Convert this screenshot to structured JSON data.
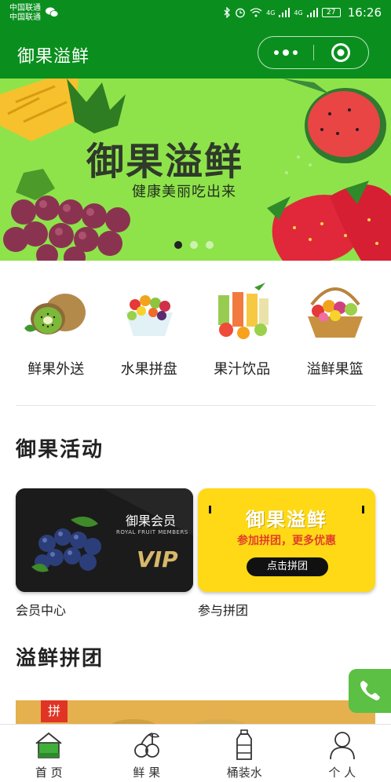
{
  "status_bar": {
    "carrier_1": "中国联通",
    "carrier_2": "中国联通",
    "network_1": "4G",
    "network_2": "4G",
    "battery": "27",
    "time": "16:26"
  },
  "header": {
    "title": "御果溢鲜"
  },
  "banner": {
    "title": "御果溢鲜",
    "subtitle": "健康美丽吃出来",
    "active_slide": 1,
    "slide_count": 3
  },
  "categories": [
    {
      "label": "鲜果外送",
      "icon": "kiwi-icon"
    },
    {
      "label": "水果拼盘",
      "icon": "fruit-platter-icon"
    },
    {
      "label": "果汁饮品",
      "icon": "juice-icon"
    },
    {
      "label": "溢鲜果篮",
      "icon": "fruit-basket-icon"
    }
  ],
  "activities": {
    "section_title": "御果活动",
    "vip_card": {
      "title": "御果会员",
      "subtitle": "ROYAL FRUIT MEMBERS",
      "mark": "VIP",
      "caption": "会员中心"
    },
    "group_card": {
      "title": "御果溢鲜",
      "subtitle": "参加拼团，更多优惠",
      "button": "点击拼团",
      "caption": "参与拼团"
    }
  },
  "group_buy": {
    "section_title": "溢鲜拼团",
    "tag": "拼"
  },
  "tabbar": [
    {
      "label": "首 页",
      "icon": "home-icon",
      "active": true
    },
    {
      "label": "鲜 果",
      "icon": "cherry-icon",
      "active": false
    },
    {
      "label": "桶装水",
      "icon": "water-bottle-icon",
      "active": false
    },
    {
      "label": "个 人",
      "icon": "user-icon",
      "active": false
    }
  ],
  "colors": {
    "brand_green": "#0a8f1e",
    "banner_green": "#8ee34b",
    "group_yellow": "#ffd915",
    "call_green": "#5bc044"
  }
}
